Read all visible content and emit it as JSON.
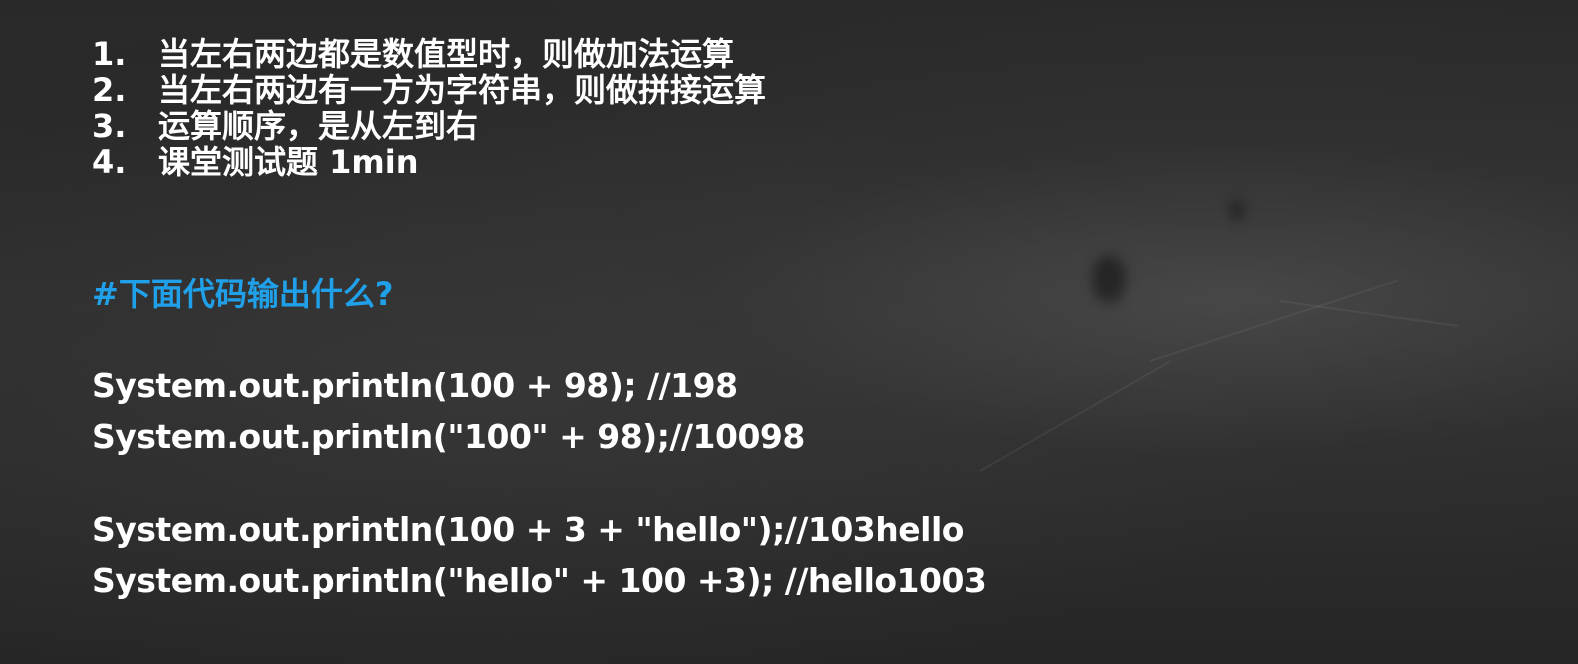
{
  "rules": [
    {
      "num": "1.",
      "text": "当左右两边都是数值型时，则做加法运算"
    },
    {
      "num": "2.",
      "text": "当左右两边有一方为字符串，则做拼接运算"
    },
    {
      "num": "3.",
      "text": "运算顺序，是从左到右"
    },
    {
      "num": "4.",
      "text": "课堂测试题 1min"
    }
  ],
  "question": "#下面代码输出什么?",
  "code_lines": [
    "System.out.println(100 + 98); //198",
    "System.out.println(\"100\" + 98);//10098",
    "System.out.println(100 + 3 + \"hello\");//103hello",
    "System.out.println(\"hello\" + 100 +3); //hello1003"
  ],
  "colors": {
    "background": "#2b2b2b",
    "text": "#ffffff",
    "accent": "#1fa0e8"
  }
}
